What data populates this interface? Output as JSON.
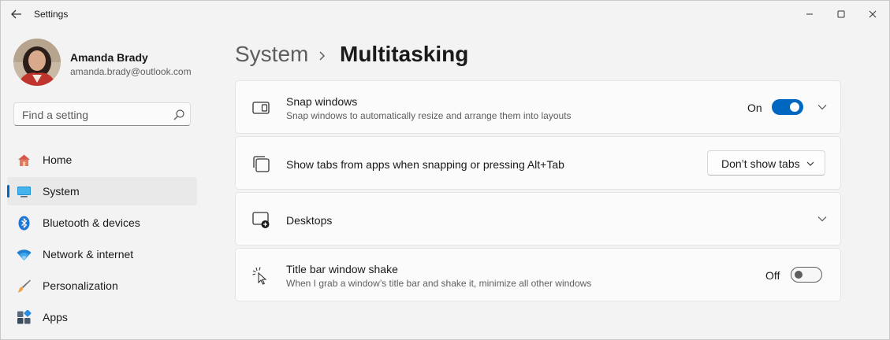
{
  "window": {
    "title": "Settings",
    "controls": [
      "minimize-icon",
      "maximize-icon",
      "close-icon"
    ]
  },
  "profile": {
    "name": "Amanda Brady",
    "email": "amanda.brady@outlook.com"
  },
  "search": {
    "placeholder": "Find a setting",
    "value": ""
  },
  "sidebar": {
    "items": [
      {
        "label": "Home",
        "icon": "home-icon",
        "selected": false
      },
      {
        "label": "System",
        "icon": "system-icon",
        "selected": true
      },
      {
        "label": "Bluetooth & devices",
        "icon": "bluetooth-icon",
        "selected": false
      },
      {
        "label": "Network & internet",
        "icon": "wifi-icon",
        "selected": false
      },
      {
        "label": "Personalization",
        "icon": "brush-icon",
        "selected": false
      },
      {
        "label": "Apps",
        "icon": "apps-icon",
        "selected": false
      }
    ]
  },
  "breadcrumb": {
    "parent": "System",
    "current": "Multitasking"
  },
  "settings": {
    "snap": {
      "title": "Snap windows",
      "description": "Snap windows to automatically resize and arrange them into layouts",
      "state_label": "On",
      "enabled": true
    },
    "tabs": {
      "title": "Show tabs from apps when snapping or pressing Alt+Tab",
      "selected_option": "Don’t show tabs"
    },
    "desktops": {
      "title": "Desktops"
    },
    "shake": {
      "title": "Title bar window shake",
      "description": "When I grab a window’s title bar and shake it, minimize all other windows",
      "state_label": "Off",
      "enabled": false
    }
  },
  "colors": {
    "accent": "#0067c0",
    "background": "#f3f3f3",
    "card": "#fbfbfb"
  }
}
